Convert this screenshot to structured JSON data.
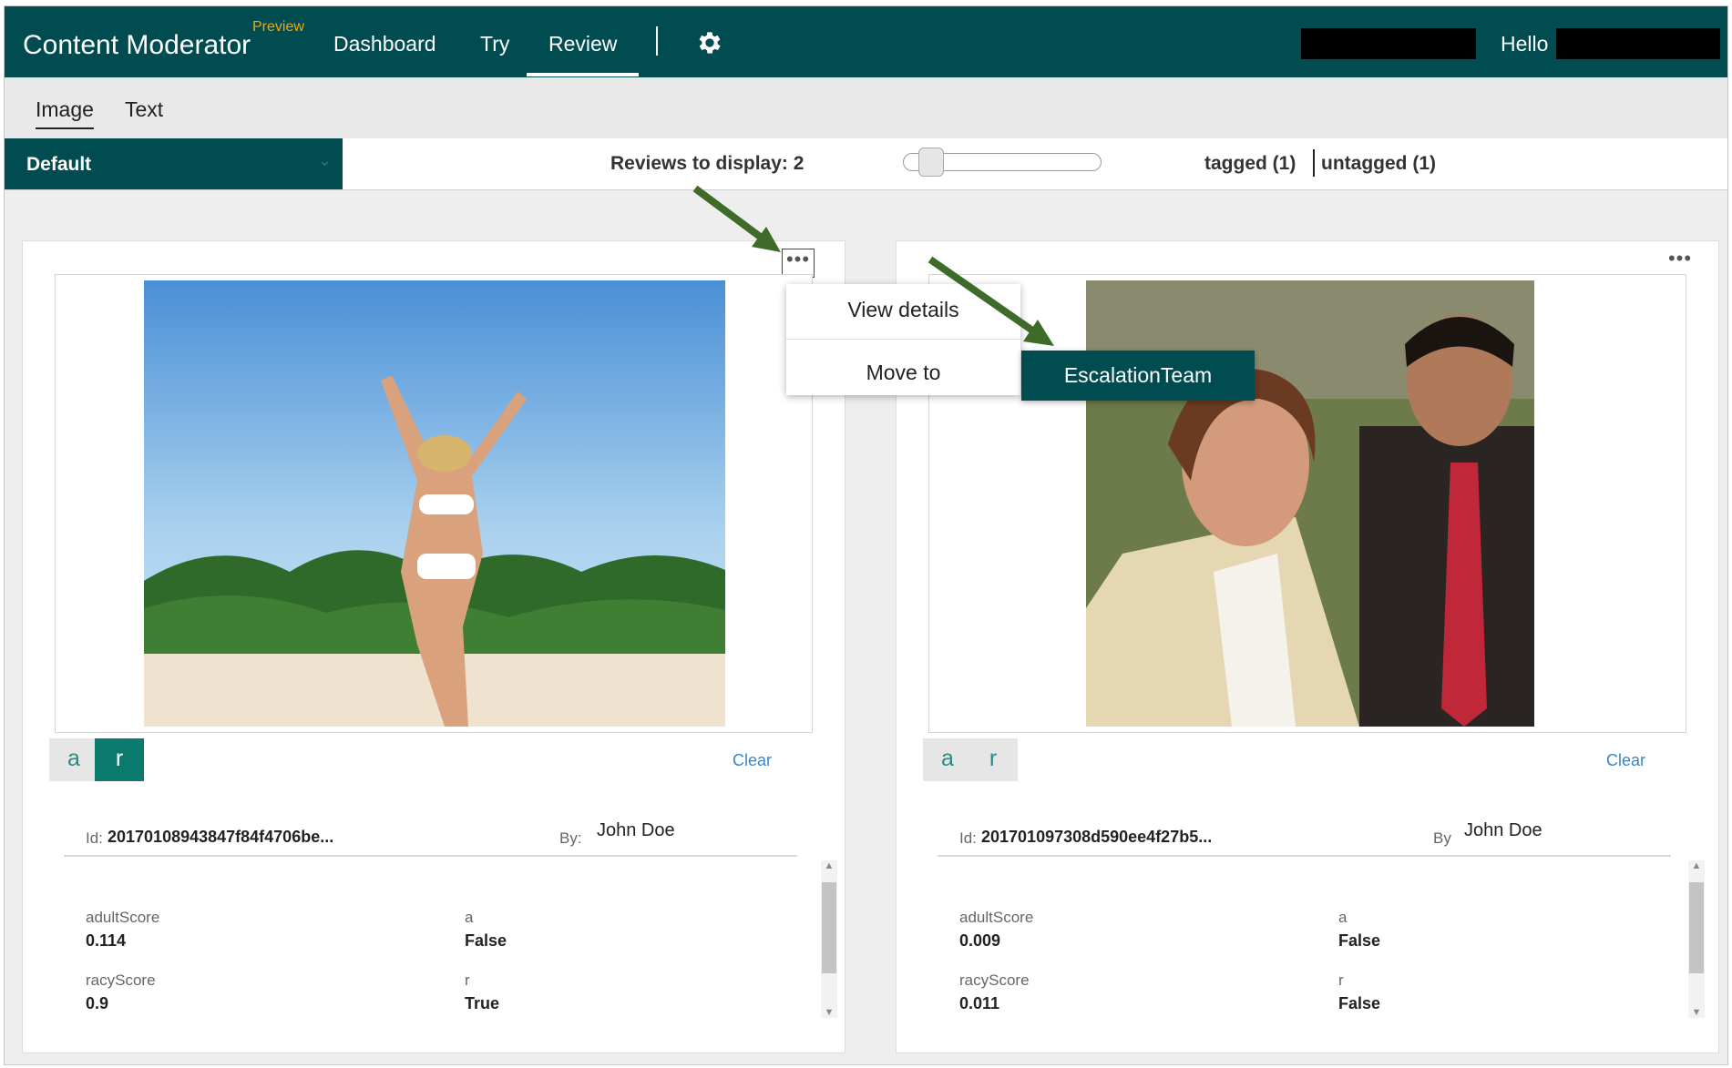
{
  "header": {
    "app_title": "Content Moderator",
    "preview_badge": "Preview",
    "nav": [
      "Dashboard",
      "Try",
      "Review"
    ],
    "active_nav": "Review",
    "hello": "Hello"
  },
  "subtabs": {
    "items": [
      "Image",
      "Text"
    ],
    "active": "Image"
  },
  "toolbar": {
    "team": "Default",
    "reviews_to_display": "Reviews to display: 2",
    "slider_value": 2,
    "tagged": "tagged (1)",
    "untagged": "untagged (1)"
  },
  "context_menu": {
    "more_label": "•••",
    "items": [
      "View details",
      "Move to"
    ],
    "submenu_item": "EscalationTeam"
  },
  "cards": [
    {
      "tags": [
        "a",
        "r"
      ],
      "active_tag": "r",
      "clear": "Clear",
      "id_label": "Id:",
      "id_value": "20170108943847f84f4706be...",
      "by_label": "By:",
      "by_value": "John Doe",
      "meta": [
        {
          "key": "adultScore",
          "value": "0.114"
        },
        {
          "key": "a",
          "value": "False"
        },
        {
          "key": "racyScore",
          "value": "0.9"
        },
        {
          "key": "r",
          "value": "True"
        }
      ]
    },
    {
      "tags": [
        "a",
        "r"
      ],
      "active_tag": "",
      "clear": "Clear",
      "id_label": "Id:",
      "id_value": "201701097308d590ee4f27b5...",
      "by_label": "By",
      "by_value": "John Doe",
      "meta": [
        {
          "key": "adultScore",
          "value": "0.009"
        },
        {
          "key": "a",
          "value": "False"
        },
        {
          "key": "racyScore",
          "value": "0.011"
        },
        {
          "key": "r",
          "value": "False"
        }
      ]
    }
  ],
  "colors": {
    "header_bg": "#004c50",
    "tag_active": "#0b7a6e",
    "preview_badge": "#f5a800",
    "link": "#3a86c4",
    "annotation_arrow": "#3f6b2a"
  }
}
